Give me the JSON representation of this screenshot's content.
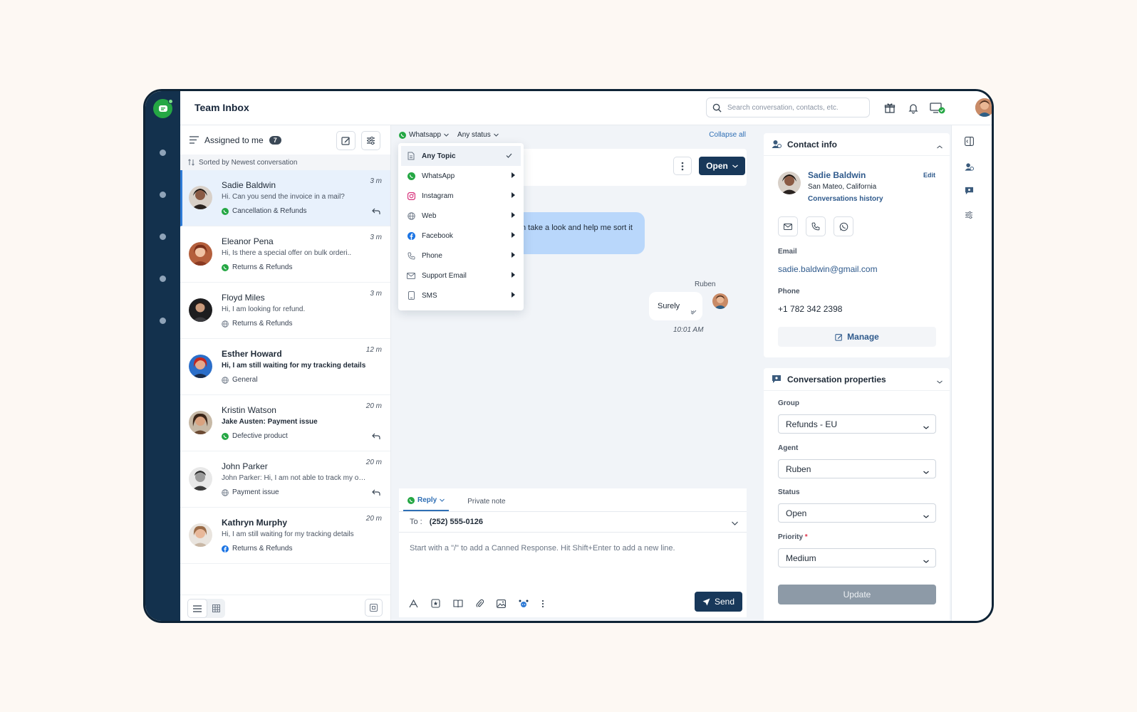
{
  "colors": {
    "rail": "#13314d",
    "brand_green": "#25a744",
    "primary": "#18385a",
    "link": "#2f6fb5",
    "selected_bg": "#e8f1fc",
    "in_bubble": "#b9d7fb"
  },
  "topbar": {
    "title": "Team Inbox",
    "search_placeholder": "Search conversation, contacts, etc.",
    "icons": [
      "gift-icon",
      "bell-icon",
      "monitor-status-icon"
    ]
  },
  "list": {
    "header_label": "Assigned to me",
    "count": "7",
    "sort_label": "Sorted by Newest conversation",
    "conversations": [
      {
        "name": "Sadie Baldwin",
        "time": "3 m",
        "preview": "Hi. Can you send the invoice in a mail?",
        "tag": "Cancellation & Refunds",
        "channel": "whatsapp",
        "unread": false,
        "replied": true,
        "active": true
      },
      {
        "name": "Eleanor Pena",
        "time": "3 m",
        "preview": "Hi, Is there a special offer on bulk orderi..",
        "tag": "Returns & Refunds",
        "channel": "whatsapp",
        "unread": false,
        "replied": false,
        "active": false
      },
      {
        "name": "Floyd Miles",
        "time": "3 m",
        "preview": "Hi, I am looking for refund.",
        "tag": "Returns & Refunds",
        "channel": "web",
        "unread": false,
        "replied": false,
        "active": false
      },
      {
        "name": "Esther Howard",
        "time": "12 m",
        "preview": "Hi, I am still waiting for my tracking details",
        "tag": "General",
        "channel": "web",
        "unread": true,
        "replied": false,
        "active": false
      },
      {
        "name": "Kristin Watson",
        "time": "20 m",
        "preview": "Jake Austen: Payment issue",
        "tag": "Defective product",
        "channel": "whatsapp",
        "unread": true,
        "replied": true,
        "active": false
      },
      {
        "name": "John Parker",
        "time": "20 m",
        "preview": "John Parker: Hi, I am not able to track my order",
        "tag": "Payment issue",
        "channel": "web",
        "unread": false,
        "replied": true,
        "active": false
      },
      {
        "name": "Kathryn Murphy",
        "time": "20 m",
        "preview": "Hi, I am still waiting for my tracking details",
        "tag": "Returns & Refunds",
        "channel": "facebook",
        "unread": true,
        "replied": false,
        "active": false
      }
    ]
  },
  "chat": {
    "filter_channel": "Whatsapp",
    "filter_status": "Any status",
    "collapse_all": "Collapse all",
    "status_button": "Open",
    "incoming_message": "n take a look and help me sort it",
    "sender": "Ruben",
    "outgoing_message": "Surely",
    "outgoing_time": "10:01 AM",
    "dropdown": [
      {
        "label": "Any Topic",
        "icon": "document-icon",
        "selected": true
      },
      {
        "label": "WhatsApp",
        "icon": "whatsapp-icon",
        "selected": false
      },
      {
        "label": "Instagram",
        "icon": "instagram-icon",
        "selected": false
      },
      {
        "label": "Web",
        "icon": "globe-icon",
        "selected": false
      },
      {
        "label": "Facebook",
        "icon": "facebook-icon",
        "selected": false
      },
      {
        "label": "Phone",
        "icon": "phone-icon",
        "selected": false
      },
      {
        "label": "Support Email",
        "icon": "mail-icon",
        "selected": false
      },
      {
        "label": "SMS",
        "icon": "sms-icon",
        "selected": false
      }
    ],
    "composer": {
      "tab_reply": "Reply",
      "tab_note": "Private note",
      "to_label": "To :",
      "to_number": "(252) 555-0126",
      "placeholder": "Start with a \"/\" to add a Canned Response. Hit Shift+Enter to add a new line.",
      "send": "Send"
    }
  },
  "contact": {
    "section_title": "Contact info",
    "name": "Sadie Baldwin",
    "edit": "Edit",
    "location": "San Mateo, California",
    "history": "Conversations history",
    "email_label": "Email",
    "email": "sadie.baldwin@gmail.com",
    "phone_label": "Phone",
    "phone": "+1 782 342 2398",
    "manage": "Manage"
  },
  "properties": {
    "section_title": "Conversation properties",
    "group_label": "Group",
    "group_value": "Refunds - EU",
    "agent_label": "Agent",
    "agent_value": "Ruben",
    "status_label": "Status",
    "status_value": "Open",
    "priority_label": "Priority",
    "priority_required": "*",
    "priority_value": "Medium",
    "update": "Update"
  }
}
